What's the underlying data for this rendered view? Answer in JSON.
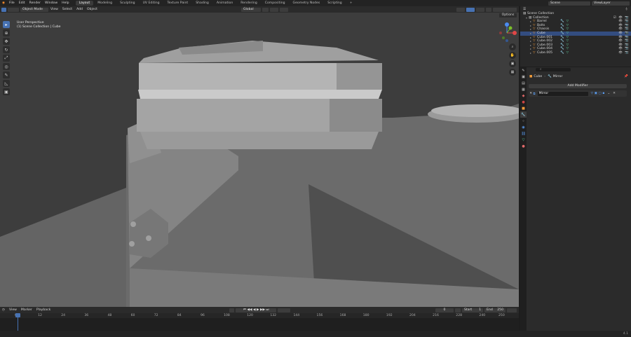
{
  "topbar": {
    "menus": [
      "File",
      "Edit",
      "Render",
      "Window",
      "Help"
    ],
    "workspaces": [
      "Layout",
      "Modeling",
      "Sculpting",
      "UV Editing",
      "Texture Paint",
      "Shading",
      "Animation",
      "Rendering",
      "Compositing",
      "Geometry Nodes",
      "Scripting"
    ],
    "active_workspace": "Layout",
    "scene": "Scene",
    "view_layer": "ViewLayer"
  },
  "viewport_header": {
    "mode": "Object Mode",
    "menus": [
      "View",
      "Select",
      "Add",
      "Object"
    ],
    "transform": "Global",
    "options": "Options"
  },
  "viewport": {
    "view_name": "User Perspective",
    "collection_path": "(1) Scene Collection | Cube"
  },
  "outliner": {
    "search_placeholder": "",
    "root": "Scene Collection",
    "collection": "Collection",
    "items": [
      "Barrel",
      "Bolts",
      "Chassis",
      "Cube",
      "Cube.001",
      "Cube.002",
      "Cube.003",
      "Cube.004",
      "Cube.005"
    ],
    "selected": "Cube"
  },
  "properties": {
    "breadcrumb_object": "Cube",
    "breadcrumb_modifier": "Mirror",
    "add_modifier": "Add Modifier",
    "modifier_name": "Mirror"
  },
  "timeline": {
    "menus": [
      "View",
      "Marker",
      "Playback"
    ],
    "current_frame": "0",
    "start_label": "Start",
    "start": "1",
    "end_label": "End",
    "end": "250",
    "ticks": [
      "0",
      "12",
      "24",
      "36",
      "48",
      "60",
      "72",
      "84",
      "96",
      "108",
      "120",
      "132",
      "144",
      "156",
      "168",
      "180",
      "192",
      "204",
      "216",
      "228",
      "240",
      "250"
    ]
  },
  "statusbar": {
    "version": "4.1"
  },
  "colors": {
    "accent": "#4772b3",
    "object": "#f39c3a",
    "modifier": "#5fd3a0"
  }
}
